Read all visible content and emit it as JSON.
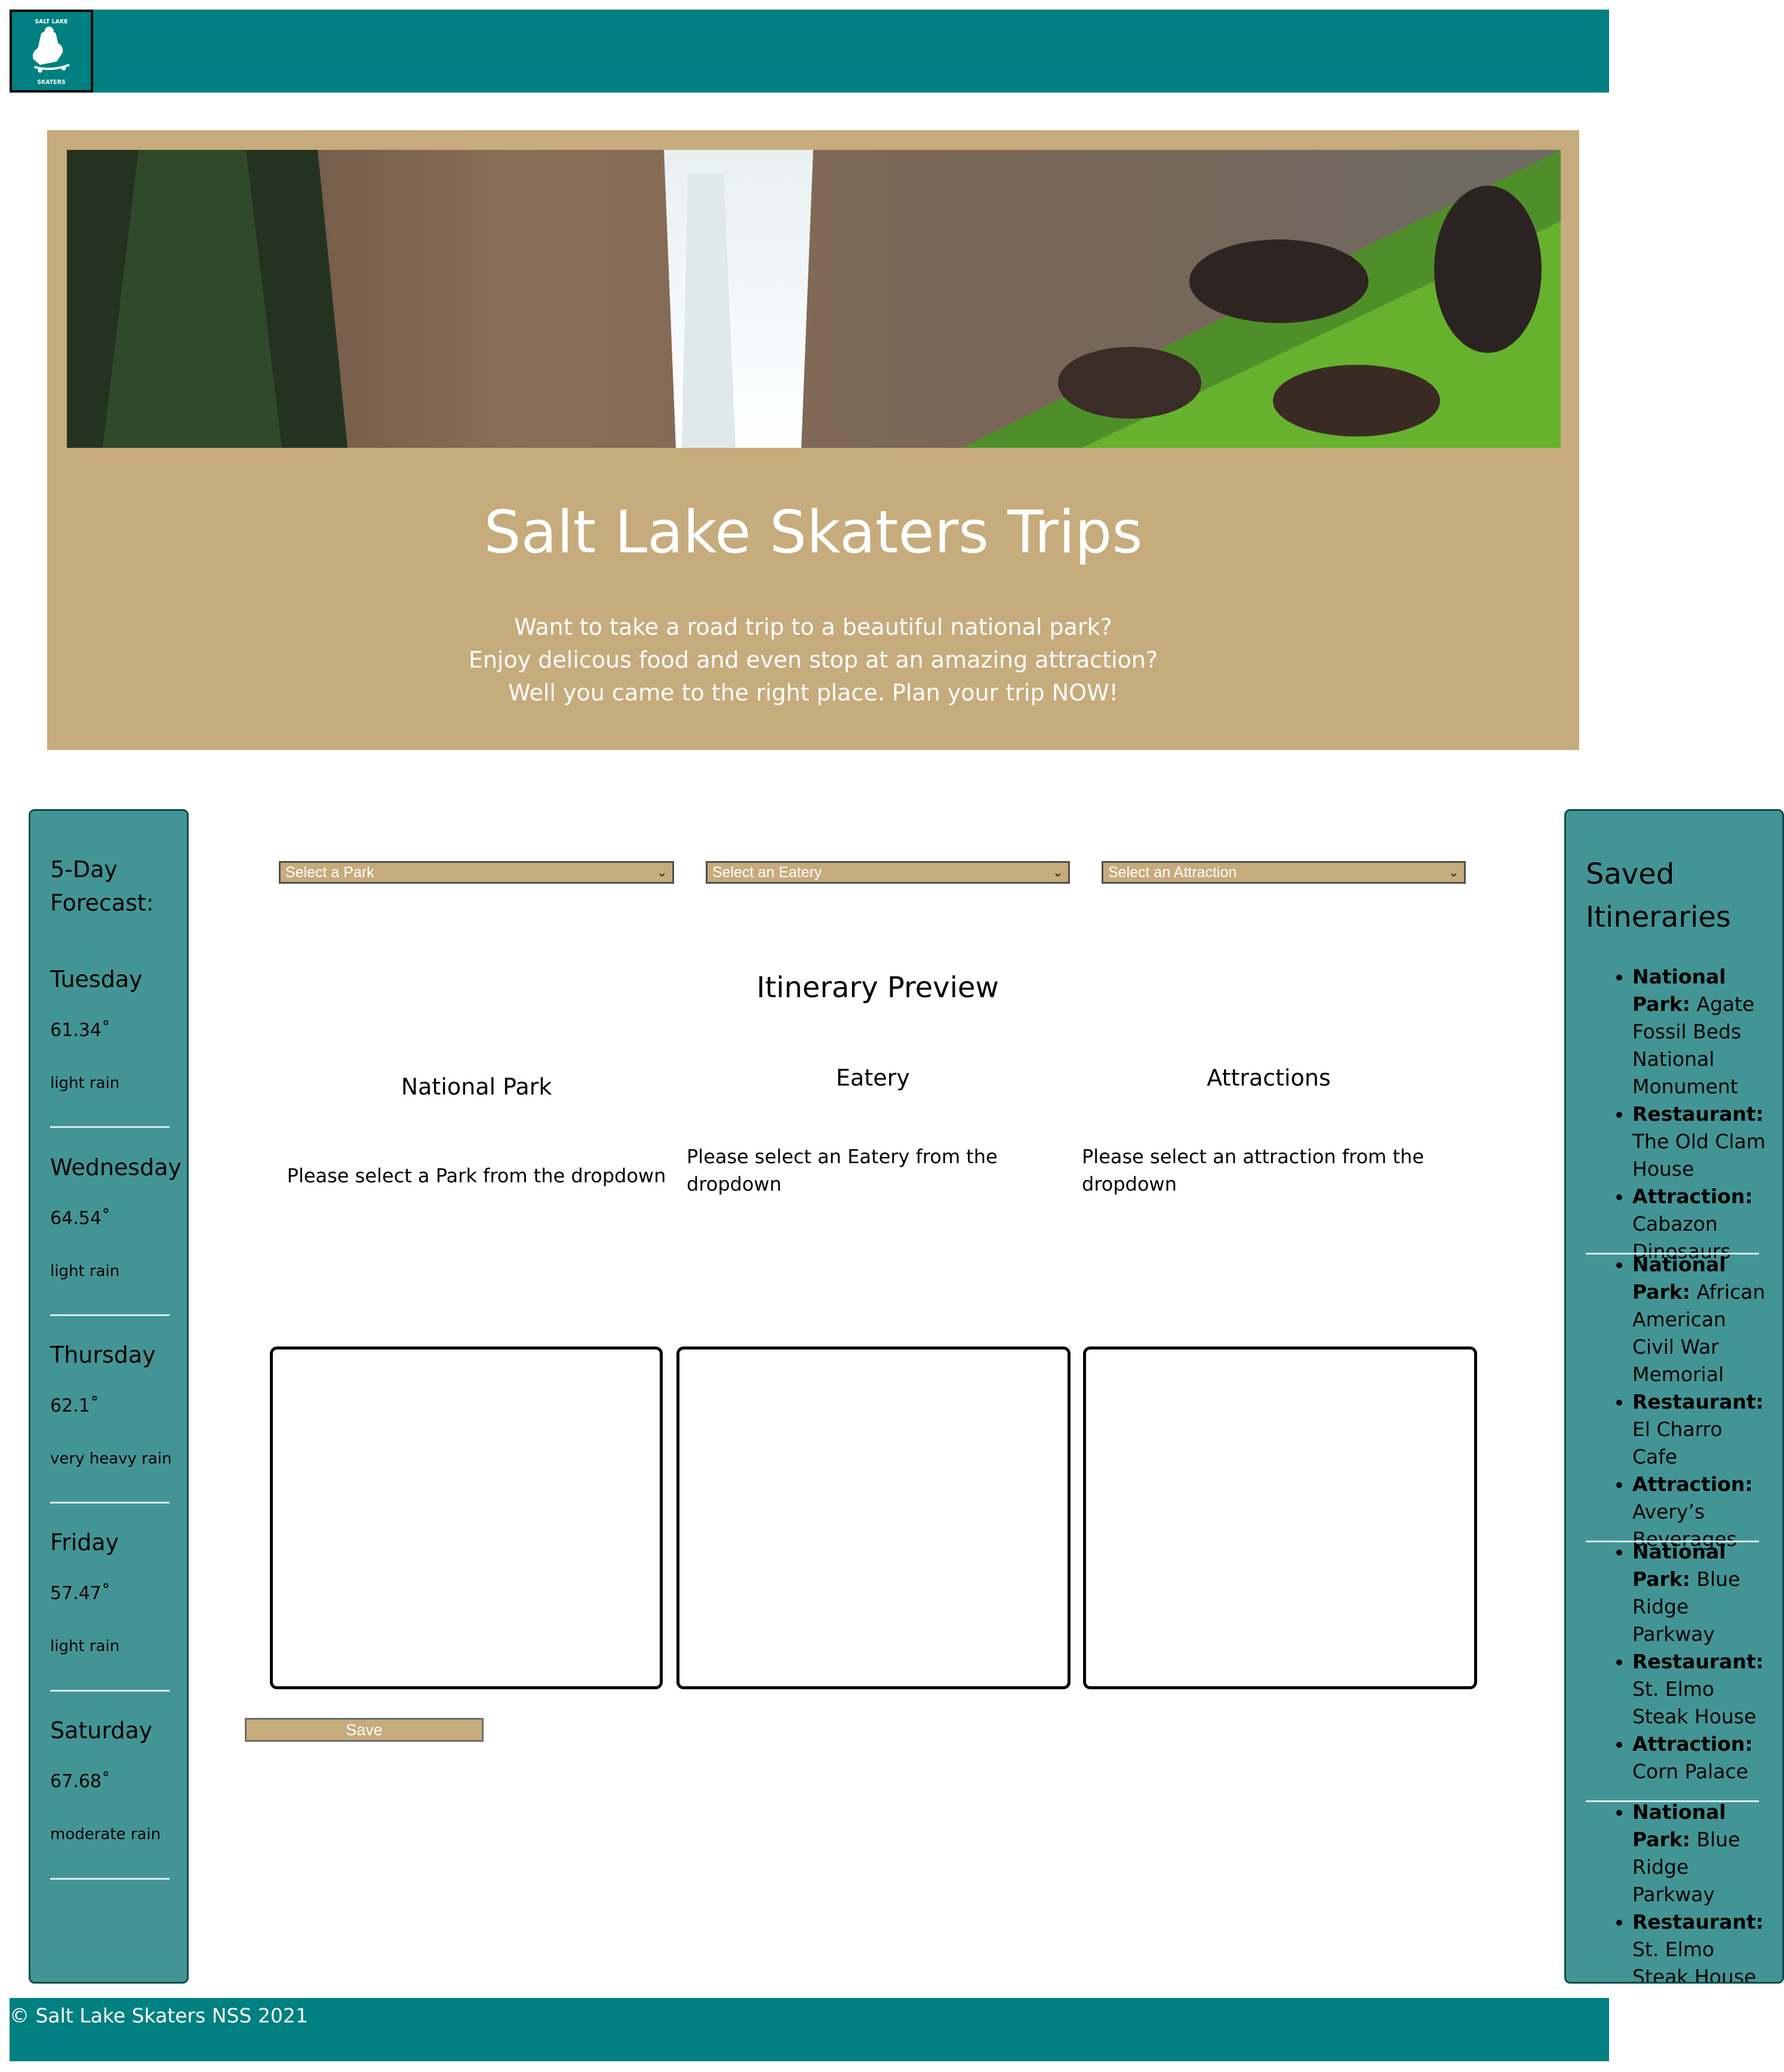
{
  "header": {
    "logo_alt": "Salt Lake Skaters logo",
    "logo_icon": "skater-logo-icon"
  },
  "hero": {
    "title": "Salt Lake Skaters Trips",
    "taglines": [
      "Want to take a road trip to a beautiful national park?",
      "Enjoy delicous food and even stop at an amazing attraction?",
      "Well you came to the right place. Plan your trip NOW!"
    ],
    "image": "waterfall-landscape"
  },
  "forecast": {
    "heading_line1": "5-Day",
    "heading_line2": "Forecast:",
    "days": [
      {
        "day": "Tuesday",
        "temp": "61.34˚",
        "desc": "light rain"
      },
      {
        "day": "Wednesday",
        "temp": "64.54˚",
        "desc": "light rain"
      },
      {
        "day": "Thursday",
        "temp": "62.1˚",
        "desc": "very heavy rain"
      },
      {
        "day": "Friday",
        "temp": "57.47˚",
        "desc": "light rain"
      },
      {
        "day": "Saturday",
        "temp": "67.68˚",
        "desc": "moderate rain"
      }
    ]
  },
  "selects": {
    "park": "Select a Park",
    "eatery": "Select an Eatery",
    "attraction": "Select an Attraction"
  },
  "preview": {
    "title": "Itinerary Preview",
    "columns": [
      {
        "heading": "National Park",
        "text": "Please select a Park from the dropdown"
      },
      {
        "heading": "Eatery",
        "text": "Please select an Eatery from the dropdown"
      },
      {
        "heading": "Attractions",
        "text": "Please select an attraction from the dropdown"
      }
    ],
    "save_label": "Save"
  },
  "saved": {
    "title": "Saved Itineraries",
    "labels": {
      "park": "National Park:",
      "restaurant": "Restaurant:",
      "attraction": "Attraction:"
    },
    "items": [
      {
        "park": "Agate Fossil Beds National Monument",
        "restaurant": "The Old Clam House",
        "attraction": "Cabazon Dinosaurs"
      },
      {
        "park": "African American Civil War Memorial",
        "restaurant": "El Charro Cafe",
        "attraction": "Avery’s Beverages"
      },
      {
        "park": "Blue Ridge Parkway",
        "restaurant": "St. Elmo Steak House",
        "attraction": "Corn Palace"
      },
      {
        "park": "Blue Ridge Parkway",
        "restaurant": "St. Elmo Steak House",
        "attraction": ""
      }
    ]
  },
  "footer": {
    "text": "© Salt Lake Skaters NSS 2021"
  },
  "colors": {
    "teal": "#008080",
    "sidebar": "#439595",
    "tan": "#c6ab7c"
  }
}
